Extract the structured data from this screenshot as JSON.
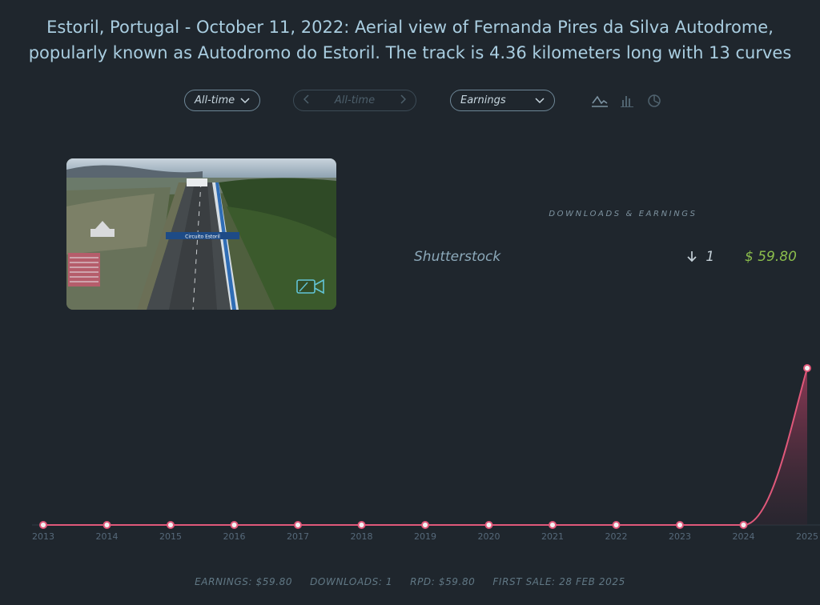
{
  "title": {
    "line1": "Estoril, Portugal - October 11, 2022: Aerial view of Fernanda Pires da Silva Autodrome,",
    "line2": "popularly known as Autodromo do Estoril. The track is 4.36 kilometers long with 13 curves"
  },
  "filters": {
    "period": "All-time",
    "range": "All-time",
    "metric": "Earnings"
  },
  "icons": [
    "line-chart-icon",
    "bar-chart-icon",
    "pie-chart-icon",
    "video-camera-icon"
  ],
  "sign_text": "Circuito Estoril",
  "stats": {
    "heading": "DOWNLOADS & EARNINGS",
    "agency": "Shutterstock",
    "downloads": "1",
    "earnings": "$ 59.80"
  },
  "colors": {
    "accent_line": "#e0587a",
    "earnings_green": "#8bbe4c",
    "background": "#1f262d"
  },
  "chart_data": {
    "type": "line",
    "x": [
      "2013",
      "2014",
      "2015",
      "2016",
      "2017",
      "2018",
      "2019",
      "2020",
      "2021",
      "2022",
      "2023",
      "2024",
      "2025"
    ],
    "values": [
      0,
      0,
      0,
      0,
      0,
      0,
      0,
      0,
      0,
      0,
      0,
      0,
      59.8
    ],
    "ylim": [
      0,
      59.8
    ]
  },
  "footer": {
    "earnings": "EARNINGS: $59.80",
    "downloads": "DOWNLOADS: 1",
    "rpd": "RPD: $59.80",
    "first_sale": "FIRST SALE: 28 FEB 2025"
  }
}
